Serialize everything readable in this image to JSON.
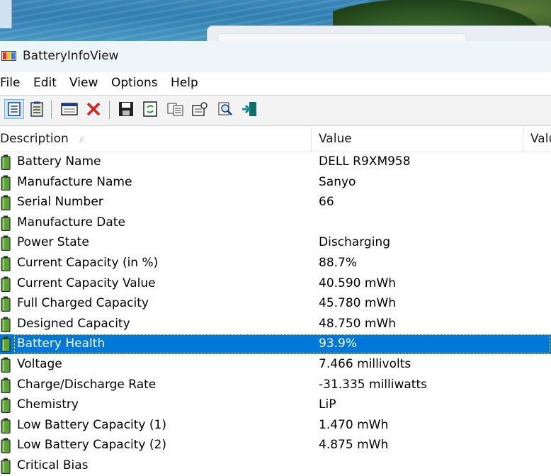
{
  "window": {
    "title": "BatteryInfoView"
  },
  "menu": [
    "File",
    "Edit",
    "View",
    "Options",
    "Help"
  ],
  "toolbar": {
    "buttons": [
      {
        "name": "html-report-all-icon"
      },
      {
        "name": "html-report-selected-icon"
      },
      {
        "name": "properties-window-icon"
      },
      {
        "name": "delete-icon"
      },
      {
        "name": "save-icon"
      },
      {
        "name": "refresh-icon"
      },
      {
        "name": "copy-icon"
      },
      {
        "name": "properties-icon"
      },
      {
        "name": "find-icon"
      },
      {
        "name": "exit-icon"
      }
    ]
  },
  "columns": {
    "description": "Description",
    "value": "Value",
    "value2": "Valu"
  },
  "rows": [
    {
      "desc": "Battery Name",
      "value": "DELL R9XM958"
    },
    {
      "desc": "Manufacture Name",
      "value": "Sanyo"
    },
    {
      "desc": "Serial Number",
      "value": "66"
    },
    {
      "desc": "Manufacture Date",
      "value": ""
    },
    {
      "desc": "Power State",
      "value": "Discharging"
    },
    {
      "desc": "Current Capacity (in %)",
      "value": "88.7%"
    },
    {
      "desc": "Current Capacity Value",
      "value": "40.590 mWh"
    },
    {
      "desc": "Full Charged Capacity",
      "value": "45.780 mWh"
    },
    {
      "desc": "Designed Capacity",
      "value": "48.750 mWh"
    },
    {
      "desc": "Battery Health",
      "value": "93.9%",
      "selected": true
    },
    {
      "desc": "Voltage",
      "value": "7.466 millivolts"
    },
    {
      "desc": "Charge/Discharge Rate",
      "value": "-31.335 milliwatts"
    },
    {
      "desc": "Chemistry",
      "value": "LiP"
    },
    {
      "desc": "Low Battery Capacity (1)",
      "value": "1.470 mWh"
    },
    {
      "desc": "Low Battery Capacity (2)",
      "value": "4.875 mWh"
    },
    {
      "desc": "Critical Bias",
      "value": ""
    }
  ],
  "colors": {
    "selection": "#0078d7",
    "battery_green": "#5ea33a"
  }
}
